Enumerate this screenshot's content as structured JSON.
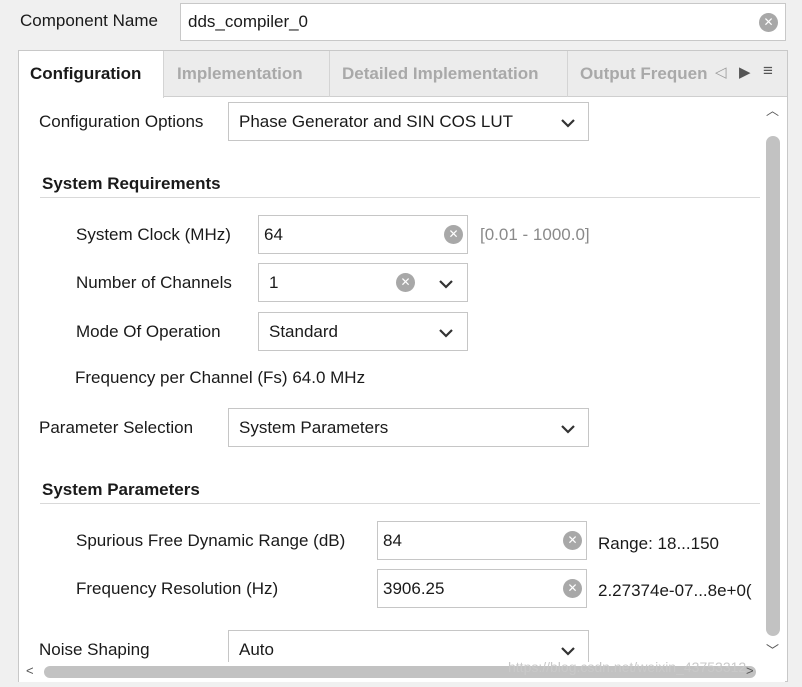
{
  "component": {
    "label": "Component Name",
    "value": "dds_compiler_0"
  },
  "tabs": [
    {
      "label": "Configuration",
      "active": true
    },
    {
      "label": "Implementation",
      "active": false
    },
    {
      "label": "Detailed Implementation",
      "active": false
    },
    {
      "label": "Output Frequen",
      "active": false
    }
  ],
  "config_options": {
    "label": "Configuration Options",
    "value": "Phase Generator and SIN COS LUT"
  },
  "system_requirements": {
    "title": "System Requirements",
    "clock": {
      "label": "System Clock (MHz)",
      "value": "64",
      "range": "[0.01 - 1000.0]"
    },
    "channels": {
      "label": "Number of Channels",
      "value": "1"
    },
    "mode": {
      "label": "Mode Of Operation",
      "value": "Standard"
    },
    "fs_text": "Frequency per Channel (Fs) 64.0 MHz"
  },
  "parameter_selection": {
    "label": "Parameter Selection",
    "value": "System Parameters"
  },
  "system_parameters": {
    "title": "System Parameters",
    "sfdr": {
      "label": "Spurious Free Dynamic Range (dB)",
      "value": "84",
      "range": "Range: 18...150"
    },
    "freq_res": {
      "label": "Frequency Resolution (Hz)",
      "value": "3906.25",
      "range": "2.27374e-07...8e+0("
    }
  },
  "noise_shaping": {
    "label": "Noise Shaping",
    "value": "Auto"
  },
  "watermark": "https://blog.csdn.net/weixin_43753312",
  "icons": {
    "clear": "clear-circle-icon",
    "dropdown": "chevron-down-icon",
    "tab_left": "triangle-left-icon",
    "tab_right": "triangle-right-icon",
    "tab_menu": "hamburger-menu-icon"
  },
  "colors": {
    "background": "#f0f0f0",
    "panel": "#ffffff",
    "inactive_tab_text": "#a9a9a9",
    "clear_icon": "#a8a8a8"
  }
}
